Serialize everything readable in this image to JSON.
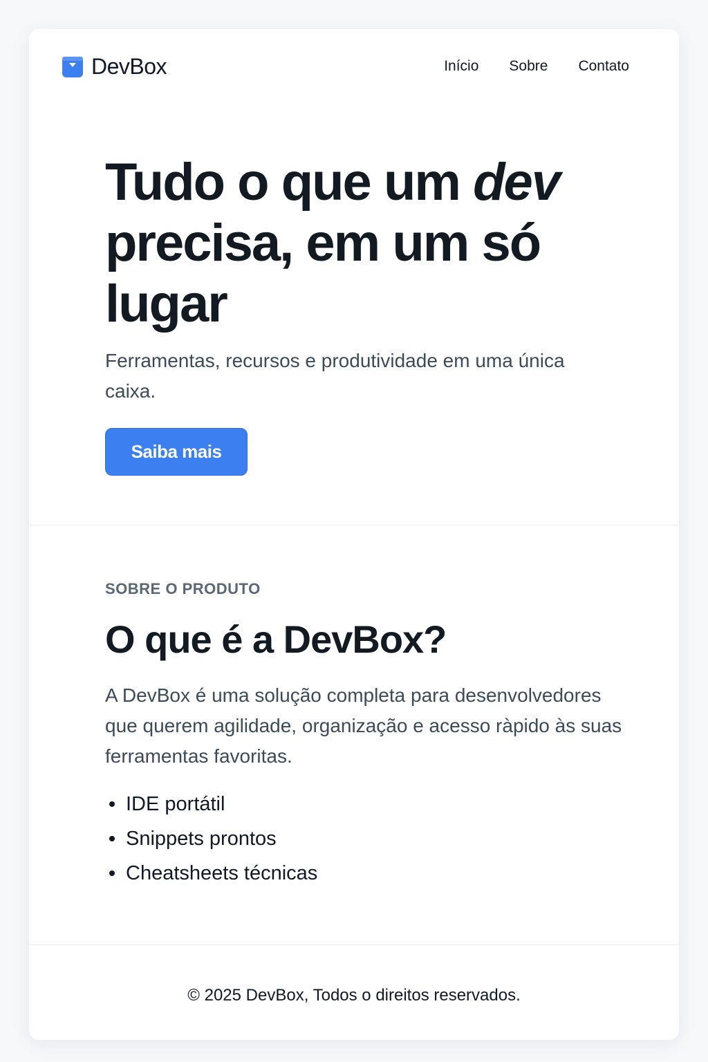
{
  "header": {
    "brand_name": "DevBox",
    "logo_icon": "box-download-icon",
    "nav": [
      {
        "label": "Início"
      },
      {
        "label": "Sobre"
      },
      {
        "label": "Contato"
      }
    ]
  },
  "hero": {
    "title_line_1": "Tudo o que um ",
    "title_emphasis": "dev",
    "title_rest": "precisa, em um só lugar",
    "subtitle": "Ferramentas, recursos e produtividade em uma única caixa.",
    "cta_label": "Saiba mais"
  },
  "about": {
    "eyebrow": "SOBRE O PRODUTO",
    "title": "O que é a DevBox?",
    "description": "A DevBox é uma solução completa para desenvolvedores que querem agilidade, organização e acesso ràpido às suas ferramentas favoritas.",
    "features": [
      "IDE portátil",
      "Snippets prontos",
      "Cheatsheets técnicas"
    ]
  },
  "footer": {
    "copyright": "© 2025 DevBox, Todos o direitos reservados."
  },
  "colors": {
    "accent": "#3b7ff0",
    "heading": "#141a22",
    "body_text": "#3d4a5a",
    "eyebrow": "#5a6778",
    "page_background": "#f7f8fa",
    "card_background": "#ffffff"
  }
}
